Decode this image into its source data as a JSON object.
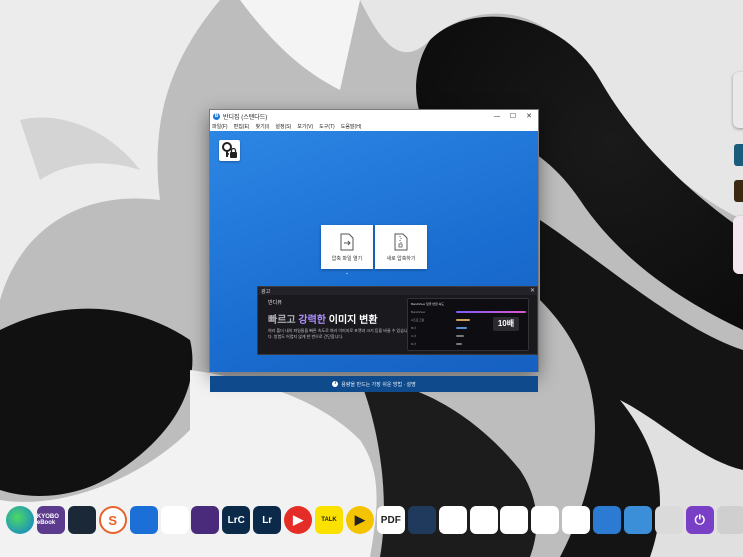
{
  "window": {
    "title": "반디집 (스탠다드)",
    "icon_letter": "B",
    "controls": {
      "minimize": "—",
      "maximize": "☐",
      "close": "✕"
    }
  },
  "menu": [
    {
      "label": "파일(F)"
    },
    {
      "label": "편집(E)"
    },
    {
      "label": "찾기(I)"
    },
    {
      "label": "설정(S)"
    },
    {
      "label": "보기(V)"
    },
    {
      "label": "도구(T)"
    },
    {
      "label": "도움말(H)"
    }
  ],
  "main": {
    "settings_icon": "key-lock-icon",
    "open_archive_label": "압축 파일 열기",
    "new_archive_label": "새로 압축하기",
    "expand_icon": "chevron-down-icon"
  },
  "ad": {
    "header": "광고",
    "close": "✕",
    "brand": "반디뷰",
    "headline_part1": "빠르고 ",
    "headline_part2": "강력한",
    "headline_part3": " 이미지 변환",
    "description": "여러 폴더 내의 파일들을 빠른 속도로 여러 이미지로 포맷과 크기 등을 바꿀 수 있습니다. 방법도 어렵지 않게 한 번으로 간단합니다.",
    "preview_title": "BandiView 일괄 변환 속도",
    "preview_rows": [
      "BandiView",
      "A프로그램",
      "B사",
      "C사",
      "D사"
    ],
    "badge": "10배"
  },
  "info_bar": {
    "icon": "info-icon",
    "text": "용량을 만드는 가장 쉬운 방법 · 설명"
  },
  "dock": {
    "items": [
      {
        "name": "edge",
        "label": "",
        "color": "#0f7bd8"
      },
      {
        "name": "kyobo-ebook",
        "label": "KYOBO eBook",
        "color": "#5c3b8f"
      },
      {
        "name": "steam",
        "label": "",
        "color": "#1b2838"
      },
      {
        "name": "scrivener",
        "label": "S",
        "color": "#ffffff"
      },
      {
        "name": "copilot",
        "label": "",
        "color": "#1c6fd6"
      },
      {
        "name": "green-app",
        "label": "",
        "color": "#ffffff"
      },
      {
        "name": "chip-app",
        "label": "",
        "color": "#4a2a7a"
      },
      {
        "name": "lightroom-classic",
        "label": "LrC",
        "color": "#0b2a4a"
      },
      {
        "name": "lightroom",
        "label": "Lr",
        "color": "#0b2a4a"
      },
      {
        "name": "youtube",
        "label": "▶",
        "color": "#e52d27"
      },
      {
        "name": "kakaotalk",
        "label": "TALK",
        "color": "#fae100"
      },
      {
        "name": "potplayer",
        "label": "▶",
        "color": "#f5c400"
      },
      {
        "name": "pdf-app",
        "label": "PDF",
        "color": "#ffffff"
      },
      {
        "name": "arrow-app",
        "label": "",
        "color": "#1f3a5c"
      },
      {
        "name": "photo-app",
        "label": "",
        "color": "#ffffff"
      },
      {
        "name": "camera-app",
        "label": "",
        "color": "#ffffff"
      },
      {
        "name": "capcut",
        "label": "",
        "color": "#ffffff"
      },
      {
        "name": "disc-app",
        "label": "",
        "color": "#ffffff"
      },
      {
        "name": "checklist-app",
        "label": "",
        "color": "#ffffff"
      },
      {
        "name": "monitor-app",
        "label": "",
        "color": "#2c7bd3"
      },
      {
        "name": "desktop-app",
        "label": "",
        "color": "#3a8fd8"
      },
      {
        "name": "tools-app",
        "label": "",
        "color": "#dadada"
      },
      {
        "name": "power-app",
        "label": "⏻",
        "color": "#7a3fc7"
      },
      {
        "name": "trash",
        "label": "",
        "color": "#cfcfcf"
      }
    ]
  },
  "colors": {
    "main_blue": "#2d86e4",
    "info_bar": "#0f4a8c",
    "ad_accent": "#b08fff"
  }
}
